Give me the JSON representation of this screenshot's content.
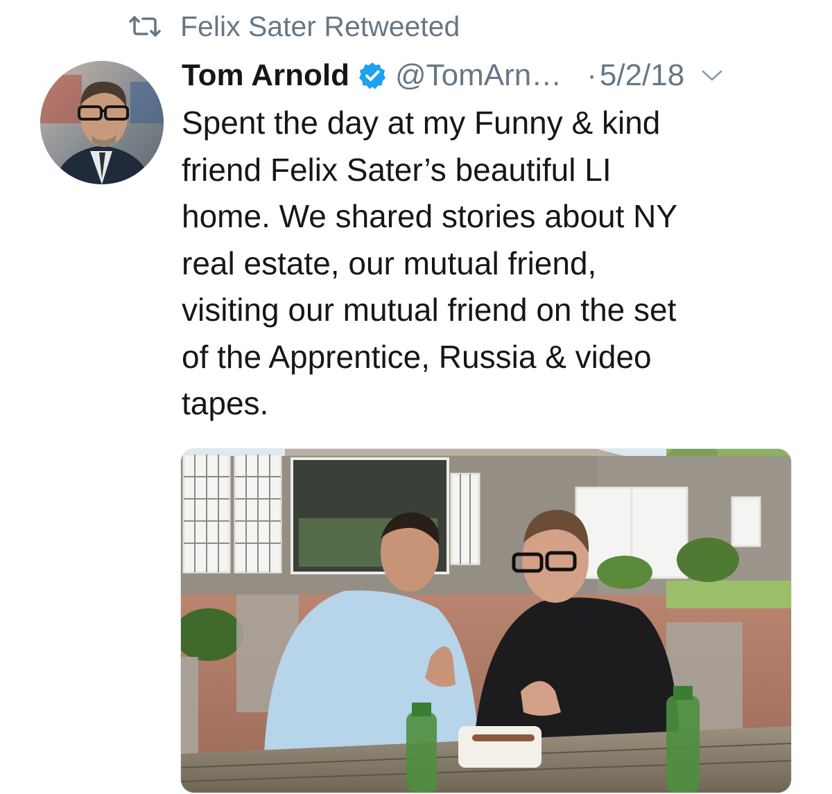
{
  "retweet": {
    "icon": "retweet-icon",
    "text": "Felix Sater Retweeted"
  },
  "tweet": {
    "author": {
      "display_name": "Tom Arnold",
      "verified": true,
      "handle": "@TomArn…",
      "avatar_icon": "avatar"
    },
    "separator": "·",
    "date": "5/2/18",
    "menu_icon": "chevron-down-icon",
    "text_lines": [
      "Spent the day at my Funny & kind",
      "friend Felix Sater’s beautiful LI",
      "home.  We shared stories about NY",
      "real estate, our mutual friend,",
      "visiting our mutual friend on the set",
      "of the Apprentice, Russia & video",
      "tapes."
    ]
  },
  "colors": {
    "text_primary": "#14171a",
    "text_secondary": "#657786",
    "verified_blue": "#1da1f2",
    "border": "#e1e8ed"
  }
}
